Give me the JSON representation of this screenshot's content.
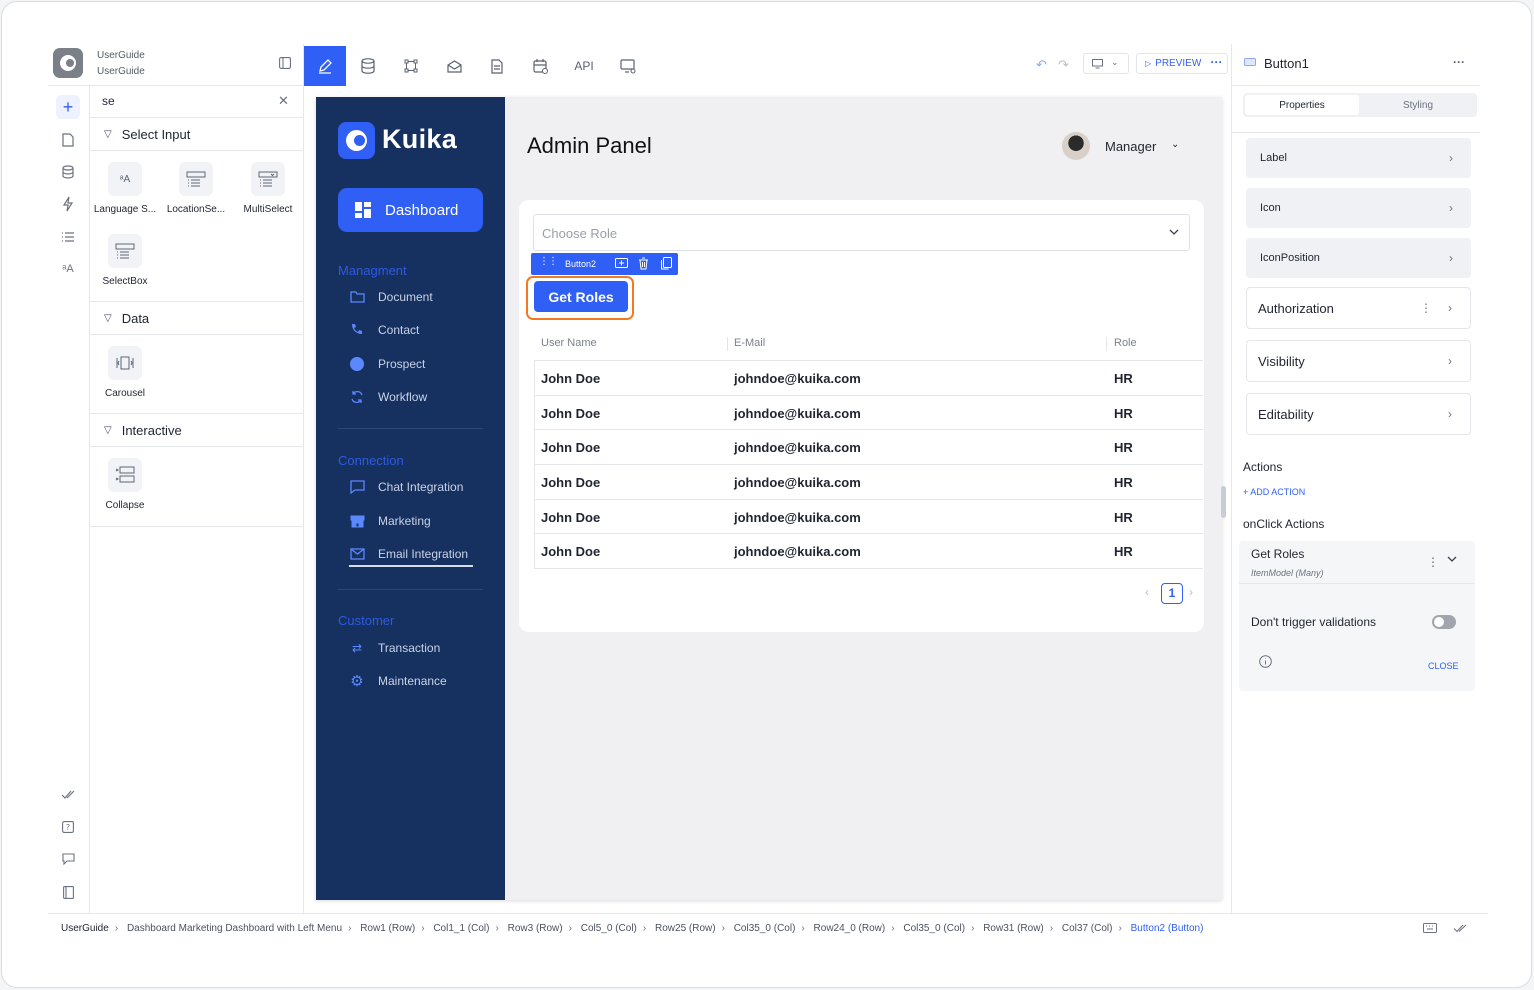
{
  "project": {
    "line1": "UserGuide",
    "line2": "UserGuide"
  },
  "toolbar": {
    "items": [
      "edit-icon",
      "database-icon",
      "workflow-icon",
      "mail-icon",
      "document-icon",
      "calendar-icon",
      "API",
      "device-settings-icon"
    ],
    "api_label": "API",
    "preview_label": "PREVIEW"
  },
  "component_panel": {
    "search_value": "se",
    "categories": [
      {
        "label": "Select Input",
        "items": [
          "Language S...",
          "LocationSe...",
          "MultiSelect",
          "SelectBox"
        ]
      },
      {
        "label": "Data",
        "items": [
          "Carousel"
        ]
      },
      {
        "label": "Interactive",
        "items": [
          "Collapse"
        ]
      }
    ]
  },
  "app": {
    "brand": "Kuika",
    "dashboard_label": "Dashboard",
    "sections": [
      {
        "title": "Managment",
        "items": [
          "Document",
          "Contact",
          "Prospect",
          "Workflow"
        ]
      },
      {
        "title": "Connection",
        "items": [
          "Chat Integration",
          "Marketing",
          "Email Integration"
        ]
      },
      {
        "title": "Customer",
        "items": [
          "Transaction",
          "Maintenance"
        ]
      }
    ],
    "page_title": "Admin Panel",
    "user_label": "Manager",
    "select_placeholder": "Choose Role",
    "selected_component_tag": "Button2",
    "button_label": "Get Roles",
    "table": {
      "headers": [
        "User Name",
        "E-Mail",
        "Role"
      ],
      "rows": [
        [
          "John Doe",
          "johndoe@kuika.com",
          "HR"
        ],
        [
          "John Doe",
          "johndoe@kuika.com",
          "HR"
        ],
        [
          "John Doe",
          "johndoe@kuika.com",
          "HR"
        ],
        [
          "John Doe",
          "johndoe@kuika.com",
          "HR"
        ],
        [
          "John Doe",
          "johndoe@kuika.com",
          "HR"
        ],
        [
          "John Doe",
          "johndoe@kuika.com",
          "HR"
        ]
      ]
    },
    "pagination": {
      "current_page": "1"
    }
  },
  "right_panel": {
    "component_name": "Button1",
    "tabs": [
      "Properties",
      "Styling"
    ],
    "properties": [
      "Label",
      "Icon",
      "IconPosition",
      "Authorization",
      "Visibility",
      "Editability"
    ],
    "actions_title": "Actions",
    "add_action": "+ ADD ACTION",
    "onclick_title": "onClick Actions",
    "action": {
      "name": "Get Roles",
      "subtitle": "ItemModel (Many)",
      "toggle_label": "Don't trigger validations",
      "toggle_on": false,
      "close_label": "CLOSE"
    }
  },
  "breadcrumb": [
    "UserGuide",
    "Dashboard Marketing Dashboard with Left Menu",
    "Row1 (Row)",
    "Col1_1 (Col)",
    "Row3 (Row)",
    "Col5_0 (Col)",
    "Row25 (Row)",
    "Col35_0 (Col)",
    "Row24_0 (Row)",
    "Col35_0 (Col)",
    "Row31 (Row)",
    "Col37 (Col)",
    "Button2 (Button)"
  ],
  "colors": {
    "accent": "#2f5ff5",
    "sidebar": "#16305f",
    "highlight": "#f47a1f"
  }
}
